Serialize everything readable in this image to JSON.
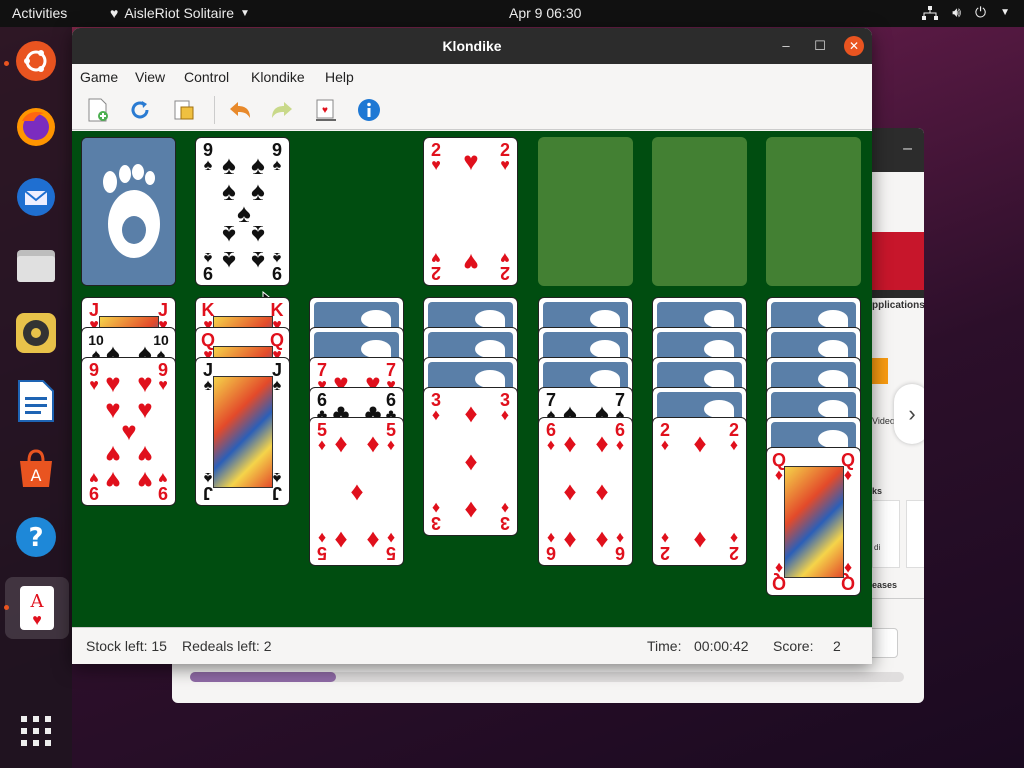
{
  "topbar": {
    "activities": "Activities",
    "app_name": "AisleRiot Solitaire",
    "clock": "Apr 9  06:30"
  },
  "window": {
    "title": "Klondike",
    "menu": [
      "Game",
      "View",
      "Control",
      "Klondike",
      "Help"
    ]
  },
  "toolbar": {
    "new_game": "new-game-icon",
    "restart": "restart-icon",
    "hint": "hint-icon",
    "undo": "undo-icon",
    "redo": "redo-icon",
    "deal": "deal-icon",
    "info": "info-icon"
  },
  "status": {
    "stock_left": "Stock left: 15",
    "redeals_left": "Redeals left: 2",
    "time_label": "Time:",
    "time_value": "00:00:42",
    "score_label": "Score:",
    "score_value": "2"
  },
  "background_window": {
    "apps_label": "pplications",
    "video_label": "Video",
    "ks_label": "ks",
    "di_label": "di",
    "eases_label": "eases"
  },
  "game": {
    "waste_top": {
      "rank": "9",
      "suit": "♠"
    },
    "foundations": [
      {
        "rank": "2",
        "suit": "♥"
      },
      null,
      null,
      null
    ],
    "tableau": [
      {
        "hidden": 0,
        "cards": [
          {
            "rank": "J",
            "suit": "♥"
          },
          {
            "rank": "10",
            "suit": "♠"
          },
          {
            "rank": "9",
            "suit": "♥"
          }
        ]
      },
      {
        "hidden": 0,
        "cards": [
          {
            "rank": "K",
            "suit": "♥"
          },
          {
            "rank": "Q",
            "suit": "♥"
          },
          {
            "rank": "J",
            "suit": "♠"
          }
        ]
      },
      {
        "hidden": 2,
        "cards": [
          {
            "rank": "7",
            "suit": "♥"
          },
          {
            "rank": "6",
            "suit": "♣"
          },
          {
            "rank": "5",
            "suit": "♦"
          }
        ]
      },
      {
        "hidden": 3,
        "cards": [
          {
            "rank": "3",
            "suit": "♦"
          }
        ]
      },
      {
        "hidden": 3,
        "cards": [
          {
            "rank": "7",
            "suit": "♠"
          },
          {
            "rank": "6",
            "suit": "♦"
          }
        ]
      },
      {
        "hidden": 4,
        "cards": [
          {
            "rank": "2",
            "suit": "♦"
          }
        ]
      },
      {
        "hidden": 5,
        "cards": [
          {
            "rank": "Q",
            "suit": "♦"
          }
        ]
      }
    ]
  }
}
